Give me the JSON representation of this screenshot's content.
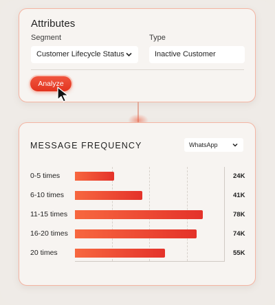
{
  "attributes": {
    "title": "Attributes",
    "segment_label": "Segment",
    "segment_value": "Customer Lifecycle Status",
    "type_label": "Type",
    "type_value": "Inactive Customer",
    "analyze_label": "Analyze"
  },
  "message_frequency": {
    "title": "MESSAGE FREQUENCY",
    "channel_value": "WhatsApp"
  },
  "chart_data": {
    "type": "bar",
    "orientation": "horizontal",
    "categories": [
      "0-5 times",
      "6-10 times",
      "11-15 times",
      "16-20 times",
      "20 times"
    ],
    "values": [
      24,
      41,
      78,
      74,
      55
    ],
    "value_labels": [
      "24K",
      "41K",
      "78K",
      "74K",
      "55K"
    ],
    "grid": true,
    "bar_color_start": "#f7673f",
    "bar_color_end": "#e4322a"
  },
  "colors": {
    "accent": "#e83a24",
    "card_border": "#f4b4a2"
  }
}
